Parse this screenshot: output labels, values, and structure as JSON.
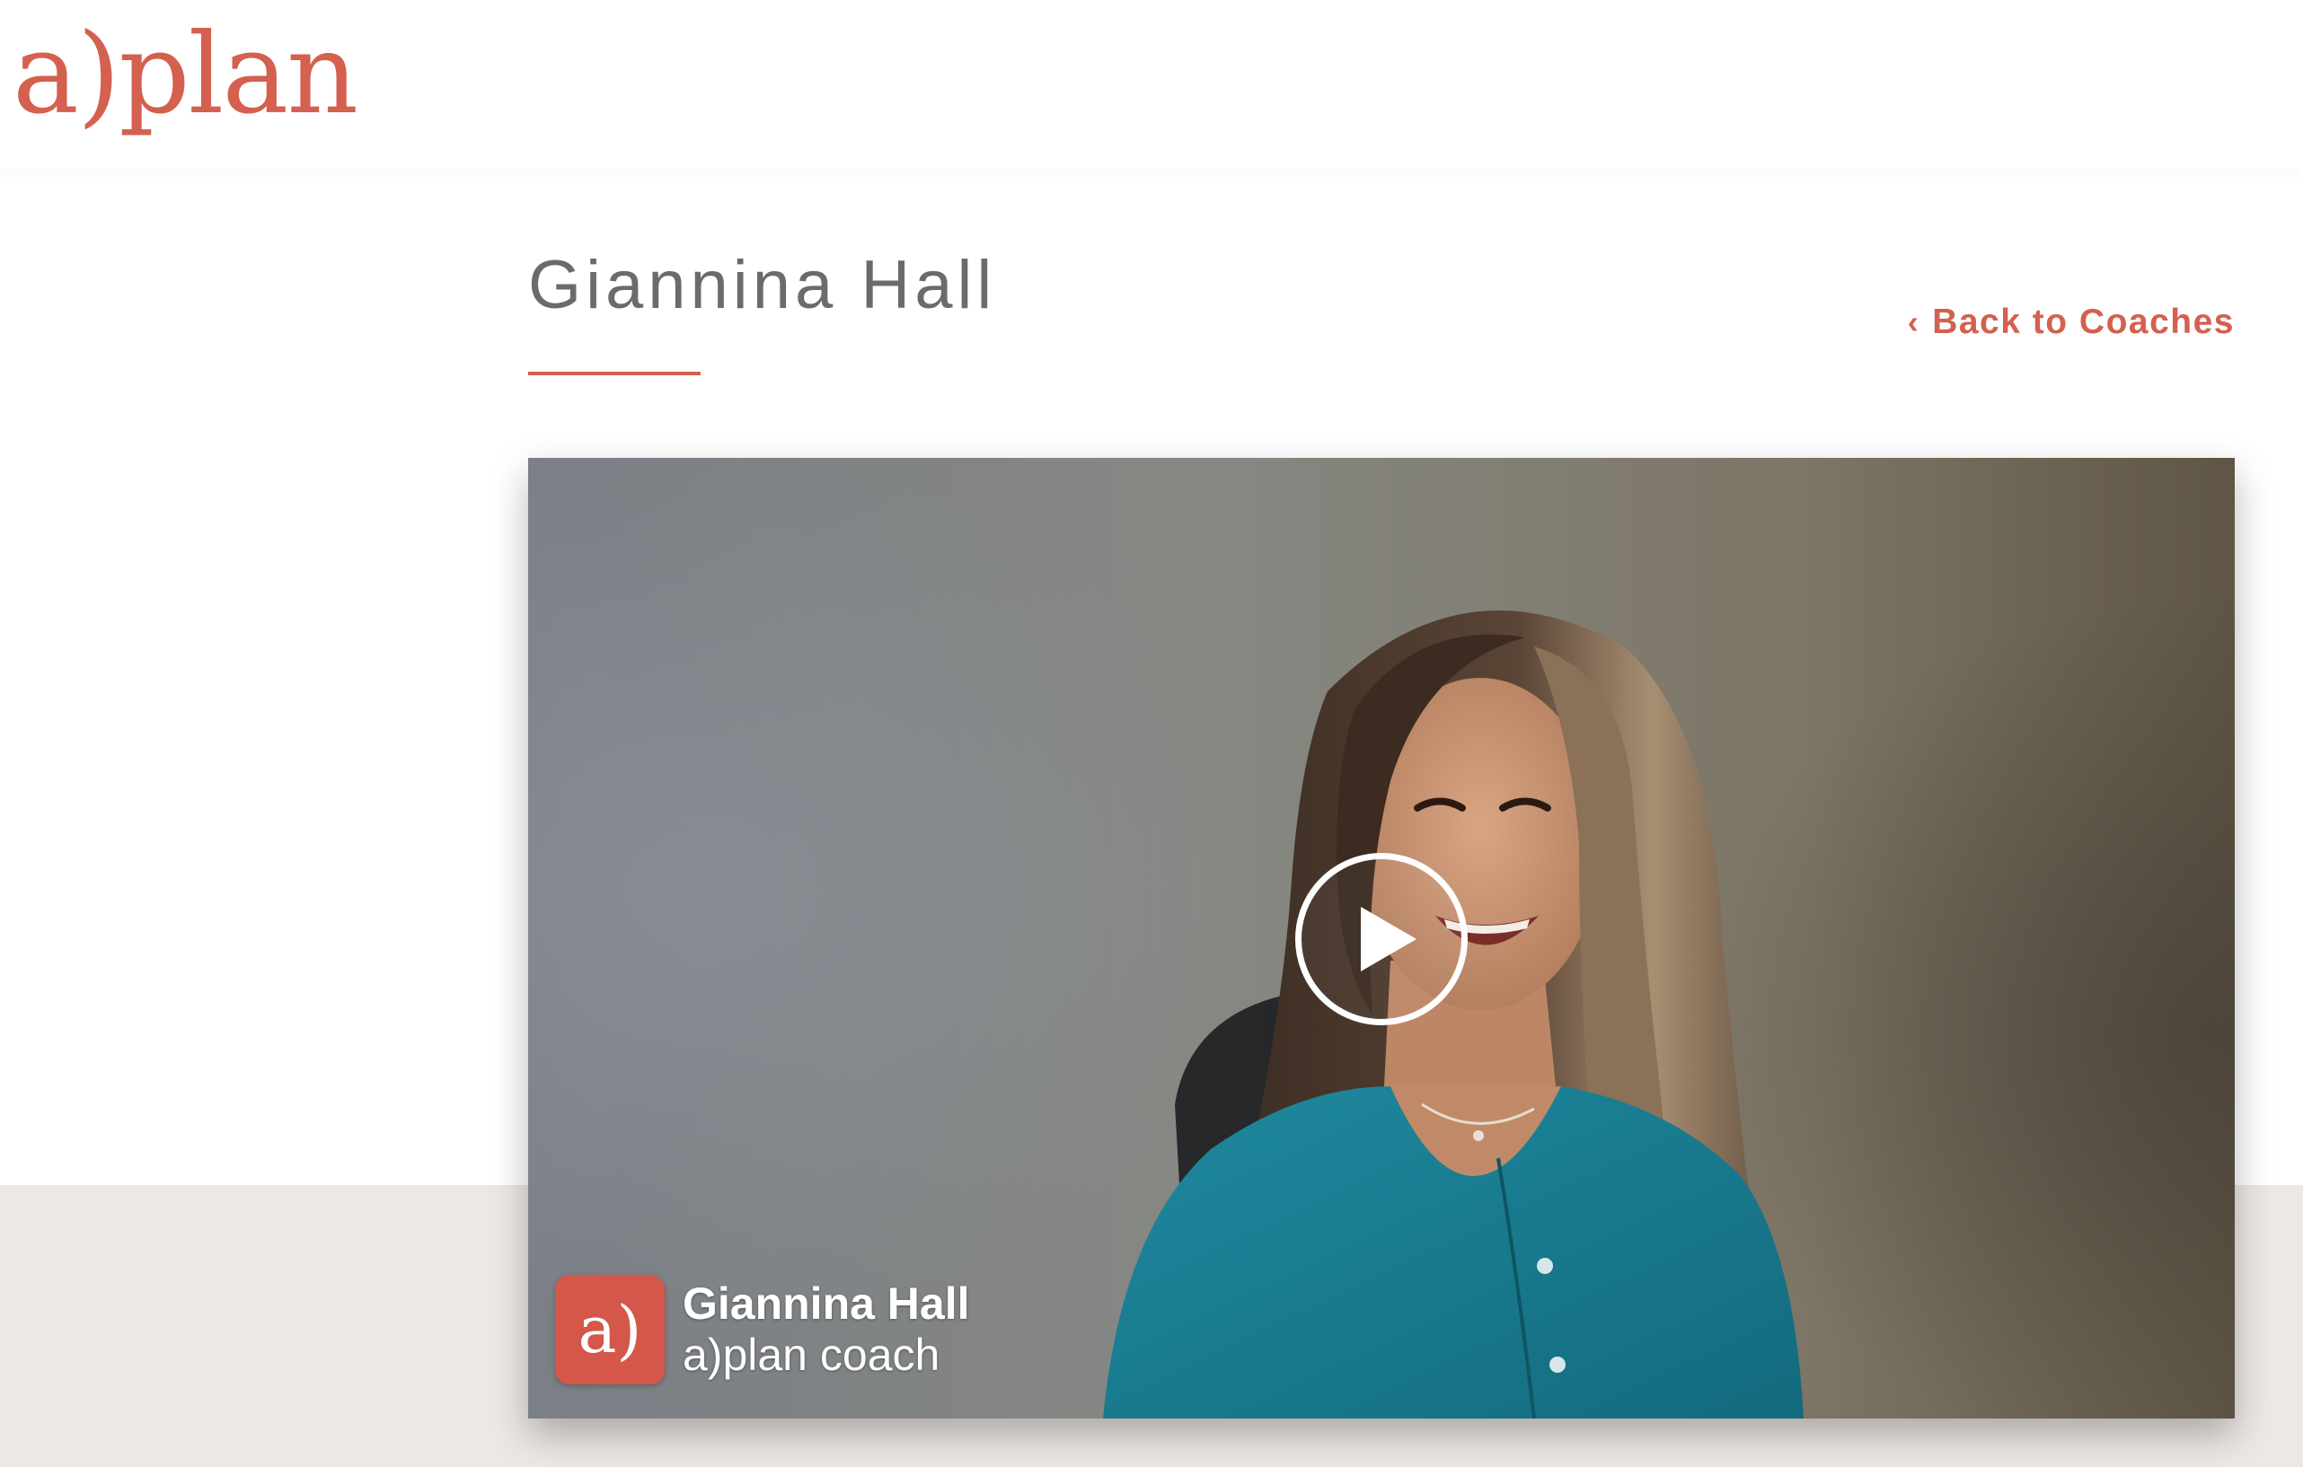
{
  "header": {
    "logo_text": "a)plan"
  },
  "coach": {
    "name": "Giannina Hall"
  },
  "nav": {
    "back_label": "Back to Coaches",
    "back_icon": "chevron-left-icon"
  },
  "video": {
    "play_icon": "play-icon",
    "overlay": {
      "badge_text": "a)",
      "name": "Giannina Hall",
      "subtitle": "a)plan coach"
    }
  },
  "colors": {
    "brand": "#d4604f",
    "title_gray": "#6b6b6b",
    "footer_band": "#ece8e5",
    "badge": "#d4574a"
  }
}
